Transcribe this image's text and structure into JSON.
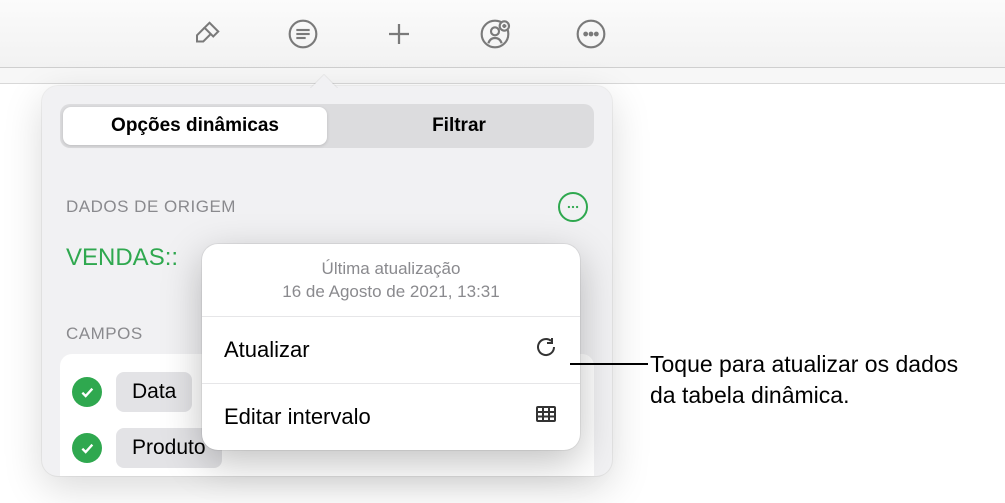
{
  "toolbar": {
    "icons": [
      "format-brush",
      "organize-menu",
      "add",
      "collaborate",
      "more"
    ]
  },
  "panel": {
    "tabs": {
      "dynamic_options": "Opções dinâmicas",
      "filter": "Filtrar"
    },
    "source_section_label": "DADOS DE ORIGEM",
    "source_name": "VENDAS::",
    "fields_label": "CAMPOS",
    "fields": [
      {
        "label": "Data",
        "checked": true
      },
      {
        "label": "Produto",
        "checked": true
      }
    ]
  },
  "popup": {
    "last_update_label": "Última atualização",
    "last_update_value": "16 de Agosto de 2021, 13:31",
    "refresh_label": "Atualizar",
    "edit_range_label": "Editar intervalo"
  },
  "callout": {
    "text": "Toque para atualizar os dados da tabela dinâmica."
  }
}
